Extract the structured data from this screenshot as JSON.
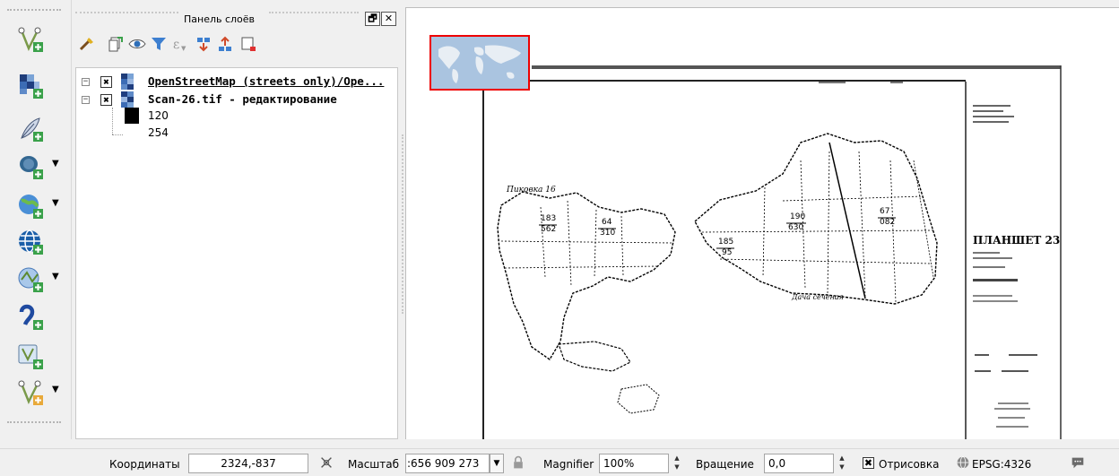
{
  "layers_panel": {
    "title": "Панель слоёв",
    "float_button": "🗗",
    "close_button": "✕",
    "layers": [
      {
        "name": "OpenStreetMap (streets only)/Ope...",
        "checked": "✖"
      },
      {
        "name": "Scan-26.tif - редактирование",
        "checked": "✖"
      }
    ],
    "legend": [
      "120",
      "254"
    ]
  },
  "map": {
    "sheet_title": "ПЛАНШЕТ 23",
    "label_top_left": "Пиковка 16",
    "label_bottom": "Дача сеченая",
    "parcels": [
      "183",
      "562",
      "64",
      "310",
      "185",
      "95",
      "190",
      "630",
      "67",
      "082"
    ]
  },
  "statusbar": {
    "coords_label": "Координаты",
    "coords_value": "2324,-837",
    "scale_label": "Масштаб",
    "scale_value": ":656 909 273",
    "magnifier_label": "Magnifier",
    "magnifier_value": "100%",
    "rotation_label": "Вращение",
    "rotation_value": "0,0",
    "render_check": "✖",
    "render_label": "Отрисовка",
    "crs_label": "EPSG:4326"
  },
  "icons": {
    "left_toolbar": [
      "new-vector-layer-icon",
      "add-raster-icon",
      "add-spatialite-icon",
      "add-postgis-icon",
      "add-wms-icon",
      "add-wcs-icon",
      "add-wfs-icon",
      "add-delimited-text-icon",
      "add-virtual-layer-icon",
      "new-shapefile-icon"
    ],
    "panel_toolbar": [
      "style-manager-icon",
      "add-group-icon",
      "visibility-icon",
      "filter-icon",
      "filter-expression-icon",
      "expand-all-icon",
      "collapse-all-icon",
      "remove-layer-icon"
    ],
    "status": [
      "coordinate-icon",
      "lock-icon",
      "globe-icon",
      "messages-icon"
    ]
  }
}
